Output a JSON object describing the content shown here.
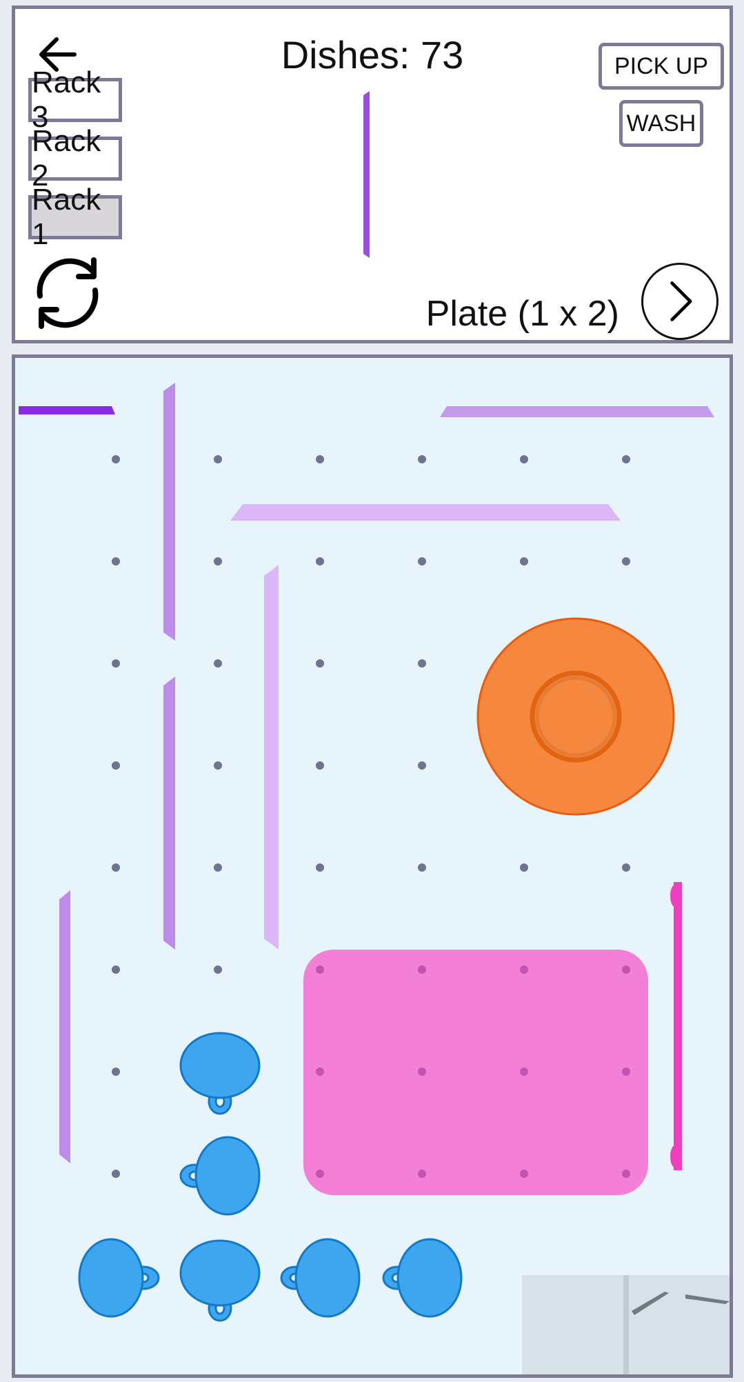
{
  "header": {
    "title": "Dishes: 73",
    "pickup_label": "PICK UP",
    "wash_label": "WASH",
    "current_item": "Plate (1 x 2)"
  },
  "racks": [
    {
      "label": "Rack 3",
      "active": false
    },
    {
      "label": "Rack 2",
      "active": false
    },
    {
      "label": "Rack 1",
      "active": true
    }
  ],
  "icons": [
    "back-arrow-icon",
    "rotate-icon",
    "next-chevron-icon"
  ],
  "colors": {
    "plate_orange": "#f5873f",
    "tray_pink": "#f47fd6",
    "cup_blue": "#3ea6ee",
    "utensil_purple": "#bd8be9",
    "peg_gray": "#6f7590"
  }
}
